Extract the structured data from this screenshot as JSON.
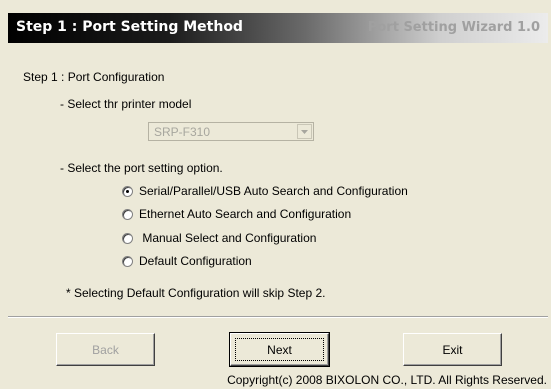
{
  "header": {
    "title": "Step 1 : Port Setting Method",
    "subtitle": "Port Setting Wizard 1.0"
  },
  "section": {
    "title": "Step 1 : Port Configuration",
    "model_label": "- Select thr printer model",
    "model_value": "SRP-F310",
    "port_label": "- Select the port setting option.",
    "options": [
      {
        "label": "Serial/Parallel/USB Auto Search and Configuration",
        "checked": true
      },
      {
        "label": "Ethernet  Auto Search and Configuration",
        "checked": false
      },
      {
        "label": " Manual Select and Configuration",
        "checked": false
      },
      {
        "label": "Default Configuration",
        "checked": false
      }
    ],
    "note": "* Selecting Default Configuration will skip Step 2."
  },
  "buttons": {
    "back": "Back",
    "next": "Next",
    "exit": "Exit"
  },
  "footer": {
    "copyright": "Copyright(c) 2008 BIXOLON CO., LTD. All Rights Reserved."
  },
  "icons": {
    "dropdown": "chevron-down-icon"
  }
}
